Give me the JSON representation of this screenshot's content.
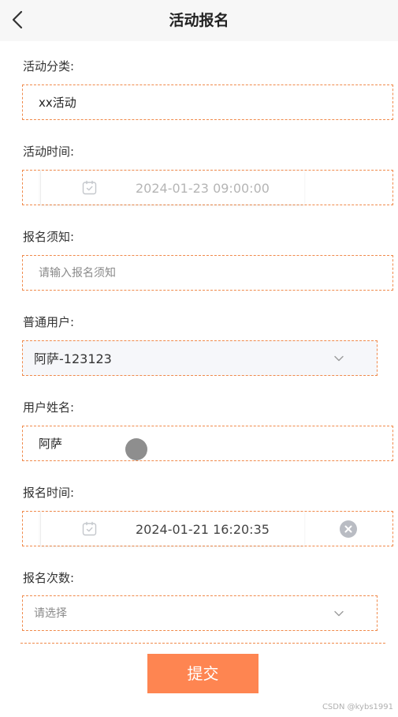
{
  "header": {
    "title": "活动报名"
  },
  "form": {
    "activity_category": {
      "label": "活动分类:",
      "value": "xx活动"
    },
    "activity_time": {
      "label": "活动时间:",
      "value": "2024-01-23 09:00:00"
    },
    "notice": {
      "label": "报名须知:",
      "placeholder": "请输入报名须知"
    },
    "normal_user": {
      "label": "普通用户:",
      "value": "阿萨-123123"
    },
    "user_name": {
      "label": "用户姓名:",
      "value": "阿萨"
    },
    "signup_time": {
      "label": "报名时间:",
      "value": "2024-01-21 16:20:35"
    },
    "signup_count": {
      "label": "报名次数:",
      "placeholder": "请选择"
    }
  },
  "submit_label": "提交",
  "watermark": "CSDN @kybs1991",
  "colors": {
    "accent": "#fe8551",
    "border": "#f08a4b",
    "header_bg": "#f7f7f7"
  }
}
